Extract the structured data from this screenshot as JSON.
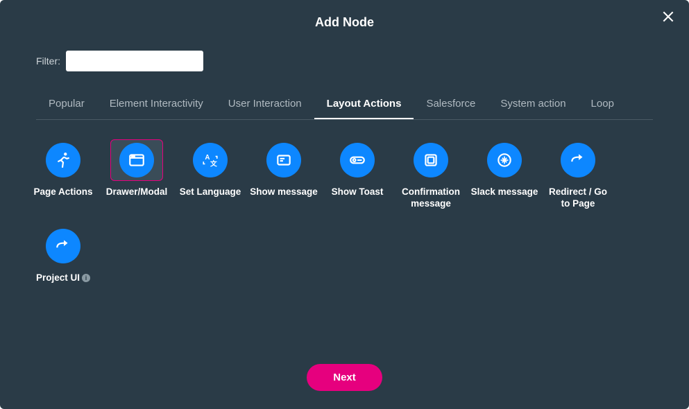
{
  "dialog": {
    "title": "Add Node",
    "close_label": "Close"
  },
  "filter": {
    "label": "Filter:",
    "value": ""
  },
  "tabs": [
    {
      "id": "popular",
      "label": "Popular",
      "active": false
    },
    {
      "id": "element-interactivity",
      "label": "Element Interactivity",
      "active": false
    },
    {
      "id": "user-interaction",
      "label": "User Interaction",
      "active": false
    },
    {
      "id": "layout-actions",
      "label": "Layout Actions",
      "active": true
    },
    {
      "id": "salesforce",
      "label": "Salesforce",
      "active": false
    },
    {
      "id": "system-action",
      "label": "System action",
      "active": false
    },
    {
      "id": "loop",
      "label": "Loop",
      "active": false
    }
  ],
  "nodes": [
    {
      "id": "page-actions",
      "label": "Page Actions",
      "icon": "running",
      "selected": false,
      "info": false
    },
    {
      "id": "drawer-modal",
      "label": "Drawer/Modal",
      "icon": "window",
      "selected": true,
      "info": false
    },
    {
      "id": "set-language",
      "label": "Set Language",
      "icon": "language",
      "selected": false,
      "info": false
    },
    {
      "id": "show-message",
      "label": "Show message",
      "icon": "message",
      "selected": false,
      "info": false
    },
    {
      "id": "show-toast",
      "label": "Show Toast",
      "icon": "toast",
      "selected": false,
      "info": false
    },
    {
      "id": "confirmation-message",
      "label": "Confirmation message",
      "icon": "confirm",
      "selected": false,
      "info": false
    },
    {
      "id": "slack-message",
      "label": "Slack message",
      "icon": "slack",
      "selected": false,
      "info": false
    },
    {
      "id": "redirect-page",
      "label": "Redirect / Go to Page",
      "icon": "redirect",
      "selected": false,
      "info": false
    },
    {
      "id": "project-ui",
      "label": "Project UI",
      "icon": "redirect",
      "selected": false,
      "info": true
    }
  ],
  "footer": {
    "next_label": "Next"
  },
  "info_badge": "i"
}
